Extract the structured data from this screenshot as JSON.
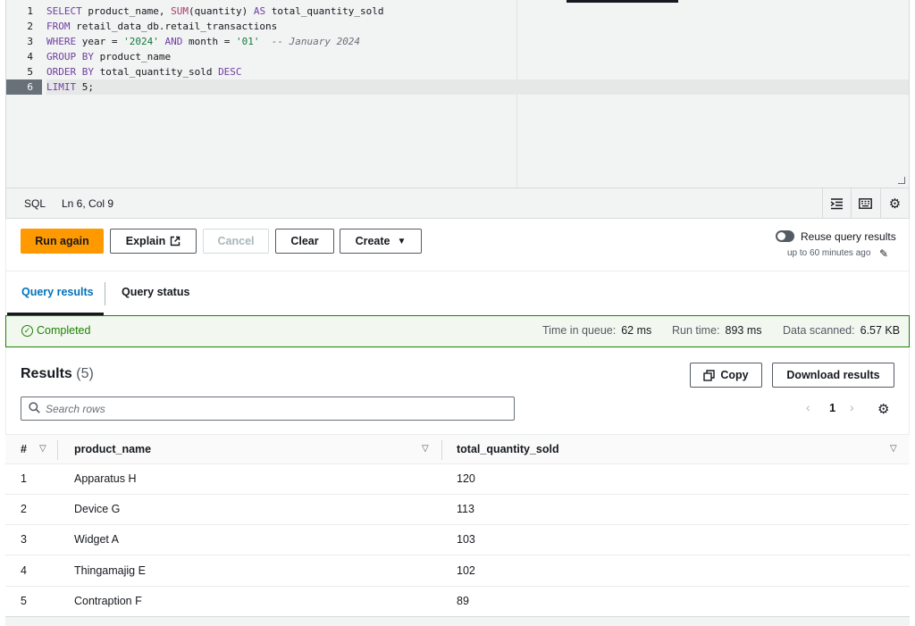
{
  "editor": {
    "line_numbers": [
      "1",
      "2",
      "3",
      "4",
      "5",
      "6"
    ],
    "active_line": 6,
    "lines": [
      [
        {
          "t": "SELECT",
          "c": "kw"
        },
        {
          "t": " product_name, ",
          "c": ""
        },
        {
          "t": "SUM",
          "c": "kwb"
        },
        {
          "t": "(quantity) ",
          "c": ""
        },
        {
          "t": "AS",
          "c": "kw"
        },
        {
          "t": " total_quantity_sold",
          "c": ""
        }
      ],
      [
        {
          "t": "FROM",
          "c": "kw"
        },
        {
          "t": " retail_data_db.retail_transactions",
          "c": ""
        }
      ],
      [
        {
          "t": "WHERE",
          "c": "kw"
        },
        {
          "t": " year = ",
          "c": ""
        },
        {
          "t": "'2024'",
          "c": "str"
        },
        {
          "t": " ",
          "c": ""
        },
        {
          "t": "AND",
          "c": "kw"
        },
        {
          "t": " month = ",
          "c": ""
        },
        {
          "t": "'01'",
          "c": "str"
        },
        {
          "t": "  ",
          "c": ""
        },
        {
          "t": "-- January 2024",
          "c": "cm"
        }
      ],
      [
        {
          "t": "GROUP BY",
          "c": "kw"
        },
        {
          "t": " product_name",
          "c": ""
        }
      ],
      [
        {
          "t": "ORDER BY",
          "c": "kw"
        },
        {
          "t": " total_quantity_sold ",
          "c": ""
        },
        {
          "t": "DESC",
          "c": "kw"
        }
      ],
      [
        {
          "t": "LIMIT",
          "c": "kw"
        },
        {
          "t": " 5;",
          "c": ""
        }
      ]
    ]
  },
  "statusbar": {
    "language": "SQL",
    "cursor": "Ln 6, Col 9",
    "icons": [
      "format-icon",
      "keyboard-icon",
      "settings-icon"
    ]
  },
  "toolbar": {
    "run_label": "Run again",
    "explain_label": "Explain",
    "cancel_label": "Cancel",
    "clear_label": "Clear",
    "create_label": "Create",
    "reuse_label": "Reuse query results",
    "reuse_sub": "up to 60 minutes ago"
  },
  "tabs": {
    "results": "Query results",
    "status": "Query status"
  },
  "banner": {
    "status": "Completed",
    "queue_label": "Time in queue:",
    "queue_value": "62 ms",
    "run_label": "Run time:",
    "run_value": "893 ms",
    "scanned_label": "Data scanned:",
    "scanned_value": "6.57 KB"
  },
  "results": {
    "title": "Results",
    "count": "(5)",
    "copy_label": "Copy",
    "download_label": "Download results",
    "search_placeholder": "Search rows",
    "page": "1"
  },
  "table": {
    "columns": [
      "#",
      "product_name",
      "total_quantity_sold"
    ],
    "rows": [
      [
        "1",
        "Apparatus H",
        "120"
      ],
      [
        "2",
        "Device G",
        "113"
      ],
      [
        "3",
        "Widget A",
        "103"
      ],
      [
        "4",
        "Thingamajig E",
        "102"
      ],
      [
        "5",
        "Contraption F",
        "89"
      ]
    ]
  },
  "colors": {
    "primary": "#ff9900",
    "link": "#0073bb",
    "success": "#1d8102"
  }
}
